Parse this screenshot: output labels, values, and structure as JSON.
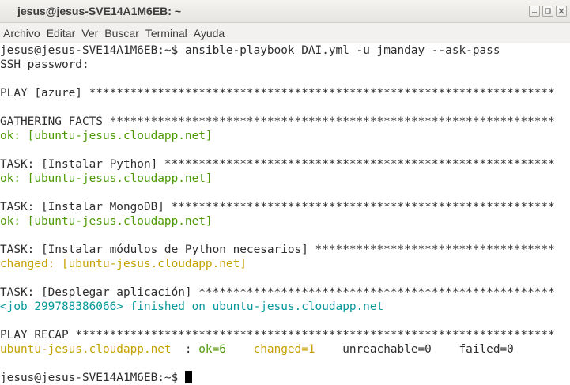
{
  "window": {
    "title": "jesus@jesus-SVE14A1M6EB: ~"
  },
  "menu": {
    "items": [
      "Archivo",
      "Editar",
      "Ver",
      "Buscar",
      "Terminal",
      "Ayuda"
    ]
  },
  "terminal": {
    "cmd_prompt": "jesus@jesus-SVE14A1M6EB:~$ ",
    "cmd_text": "ansible-playbook DAI.yml -u jmanday --ask-pass",
    "ssh_password": "SSH password:",
    "play_header": "PLAY [azure] ********************************************************************",
    "gathering_header": "GATHERING FACTS *****************************************************************",
    "gathering_result": "ok: [ubuntu-jesus.cloudapp.net]",
    "task1_header": "TASK: [Instalar Python] *********************************************************",
    "task1_result": "ok: [ubuntu-jesus.cloudapp.net]",
    "task2_header": "TASK: [Instalar MongoDB] ********************************************************",
    "task2_result": "ok: [ubuntu-jesus.cloudapp.net]",
    "task3_header": "TASK: [Instalar módulos de Python necesarios] ***********************************",
    "task3_result": "changed: [ubuntu-jesus.cloudapp.net]",
    "task4_header": "TASK: [Desplegar aplicación] ****************************************************",
    "task4_result": "<job 299788386066> finished on ubuntu-jesus.cloudapp.net",
    "recap_header": "PLAY RECAP **********************************************************************",
    "recap": {
      "host": "ubuntu-jesus.cloudapp.net",
      "sep": "  : ",
      "ok": "ok=6",
      "changed": "changed=1",
      "unreachable": "unreachable=0",
      "failed": "failed=0"
    },
    "final_prompt": "jesus@jesus-SVE14A1M6EB:~$"
  },
  "colors": {
    "ok": "#4e9a06",
    "changed": "#c4a000",
    "job": "#06989a",
    "text": "#2e2e2e"
  }
}
